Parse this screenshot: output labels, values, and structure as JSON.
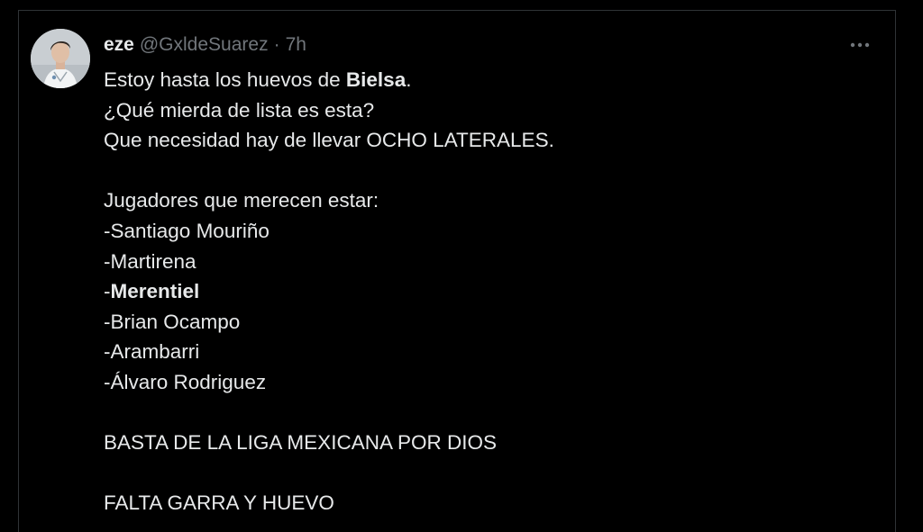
{
  "tweet": {
    "display_name": "eze",
    "handle": "@GxldeSuarez",
    "separator": "·",
    "time": "7h",
    "more_icon": "ellipsis-icon",
    "avatar_icon": "user-avatar",
    "lines": {
      "l1_pre": "Estoy hasta los huevos de ",
      "l1_bold": "Bielsa",
      "l1_post": ".",
      "l2": "¿Qué mierda de lista es esta?",
      "l3": "Que necesidad hay de llevar OCHO LATERALES.",
      "l4": "Jugadores que merecen estar:",
      "l5": "-Santiago Mouriño",
      "l6": "-Martirena",
      "l7_pre": "-",
      "l7_bold": "Merentiel",
      "l8": "-Brian Ocampo",
      "l9": "-Arambarri",
      "l10": "-Álvaro Rodriguez",
      "l11": "BASTA DE LA LIGA MEXICANA POR DIOS",
      "l12": "FALTA GARRA Y HUEVO"
    }
  },
  "colors": {
    "background": "#000000",
    "text_primary": "#e7e9ea",
    "text_secondary": "#71767b",
    "border": "#2f3336"
  }
}
